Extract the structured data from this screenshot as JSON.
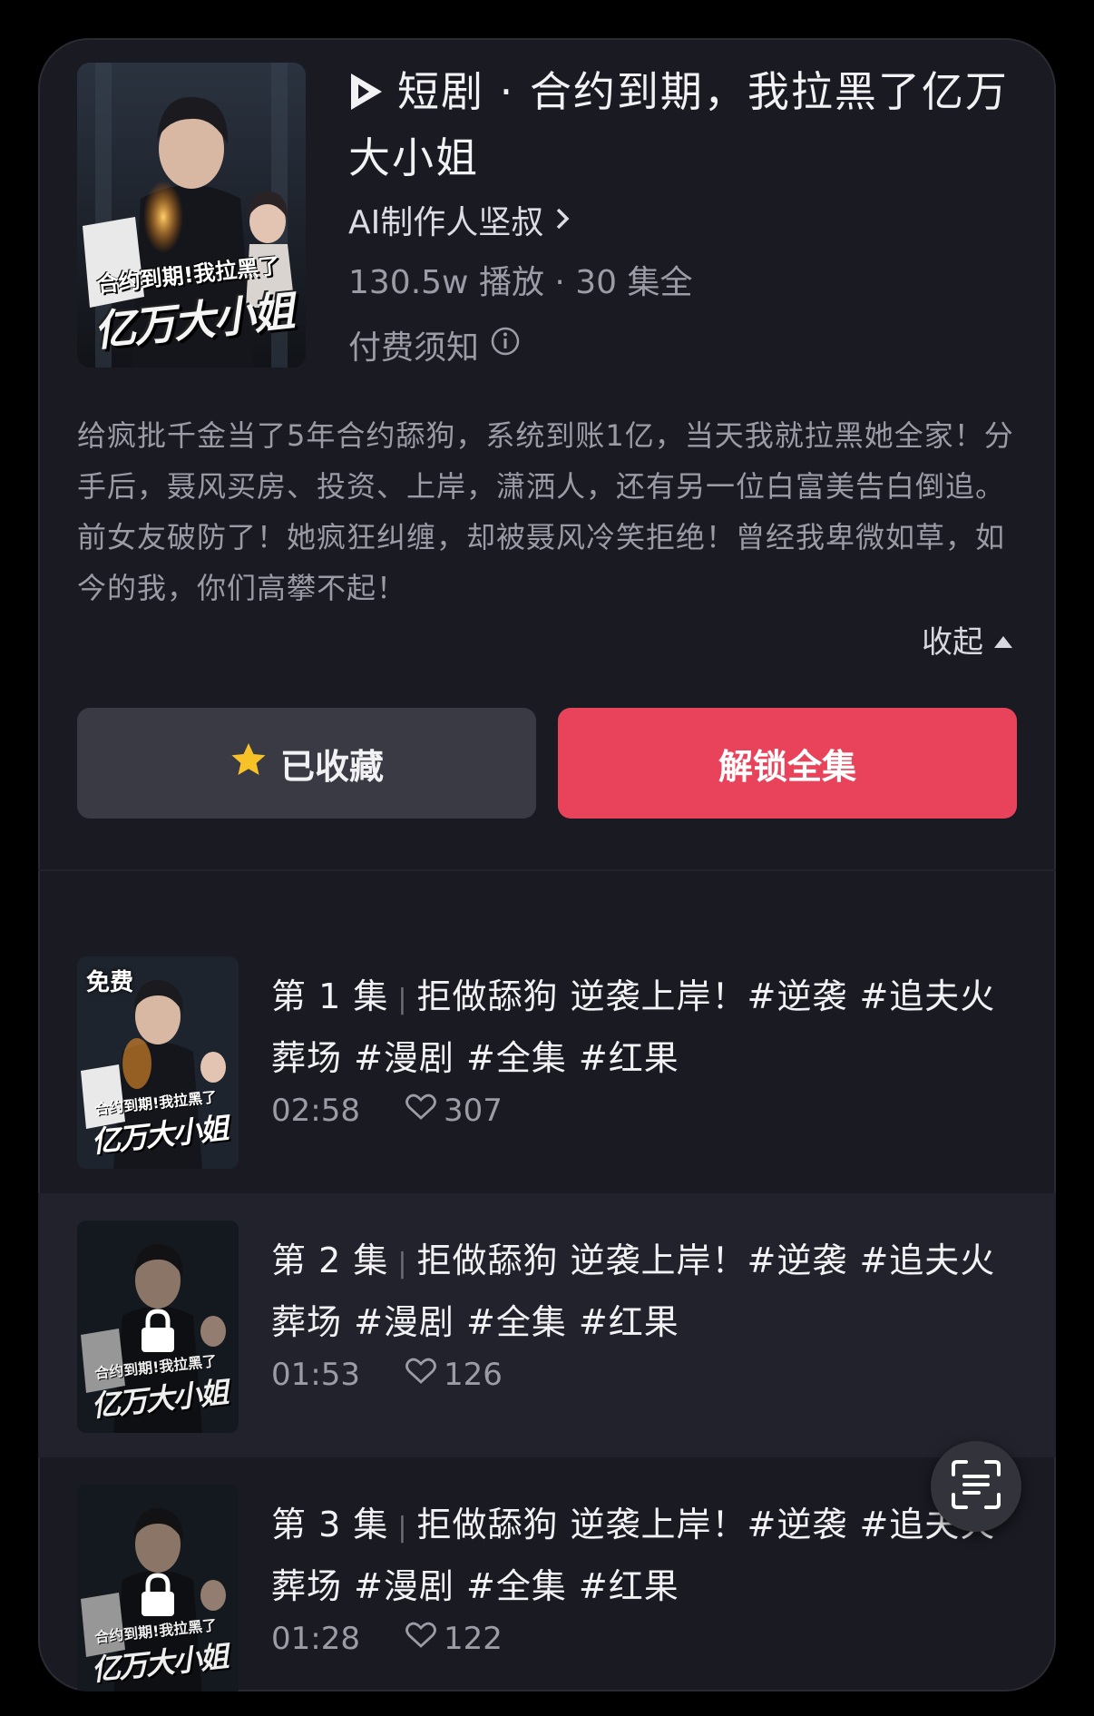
{
  "drama": {
    "title": "短剧 · 合约到期，我拉黑了亿万大小姐",
    "creator": "AI制作人坚叔",
    "stats": "130.5w 播放 · 30 集全",
    "notice": "付费须知",
    "cover_text_top": "合约到期!我拉黑了",
    "cover_text_bottom": "亿万大小姐",
    "description": "给疯批千金当了5年合约舔狗，系统到账1亿，当天我就拉黑她全家！分手后，聂风买房、投资、上岸，潇洒人，还有另一位白富美告白倒追。前女友破防了！她疯狂纠缠，却被聂风冷笑拒绝！曾经我卑微如草，如今的我，你们高攀不起！",
    "collapse_label": "收起"
  },
  "actions": {
    "favorite_label": "已收藏",
    "unlock_label": "解锁全集"
  },
  "episodes": [
    {
      "number": "第 1 集",
      "title": "拒做舔狗 逆袭上岸！#逆袭 #追夫火葬场 #漫剧 #全集 #红果",
      "duration": "02:58",
      "likes": "307",
      "badge": "免费"
    },
    {
      "number": "第 2 集",
      "title": "拒做舔狗 逆袭上岸！#逆袭 #追夫火葬场 #漫剧 #全集 #红果",
      "duration": "01:53",
      "likes": "126"
    },
    {
      "number": "第 3 集",
      "title": "拒做舔狗 逆袭上岸！#逆袭 #追夫火葬场 #漫剧 #全集 #红果",
      "duration": "01:28",
      "likes": "122"
    }
  ],
  "colors": {
    "accent": "#e8435a",
    "card_bg": "#1a1a23",
    "star": "#f6c228"
  },
  "icons": {
    "title": "play-logo-icon",
    "creator": "chevron-right-icon",
    "notice": "info-icon",
    "collapse": "caret-up-icon",
    "favorite": "star-icon",
    "like": "heart-icon",
    "lock": "lock-icon",
    "scan": "scan-text-icon"
  }
}
